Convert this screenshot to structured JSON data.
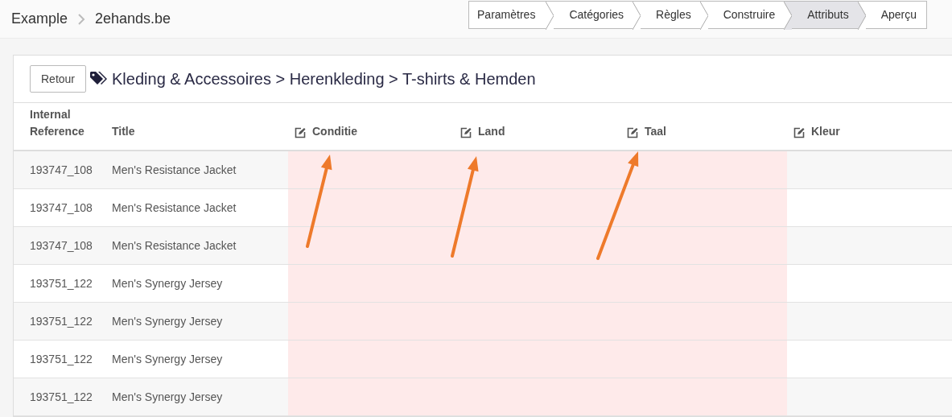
{
  "breadcrumb": [
    "Example",
    "2ehands.be"
  ],
  "steps": [
    {
      "label": "Paramètres",
      "selected": false
    },
    {
      "label": "Catégories",
      "selected": false
    },
    {
      "label": "Règles",
      "selected": false
    },
    {
      "label": "Construire",
      "selected": false
    },
    {
      "label": "Attributs",
      "selected": true
    },
    {
      "label": "Aperçu",
      "selected": false
    }
  ],
  "back_button": "Retour",
  "category_path": "Kleding & Accessoires > Herenkleding > T-shirts & Hemden",
  "table": {
    "columns": [
      {
        "label": "Internal Reference",
        "kind": "text",
        "highlighted": false
      },
      {
        "label": "Title",
        "kind": "text",
        "highlighted": false
      },
      {
        "label": "Conditie",
        "kind": "attribute",
        "highlighted": true
      },
      {
        "label": "Land",
        "kind": "attribute",
        "highlighted": true
      },
      {
        "label": "Taal",
        "kind": "attribute",
        "highlighted": true
      },
      {
        "label": "Kleur",
        "kind": "attribute",
        "highlighted": false
      }
    ],
    "rows": [
      [
        "193747_108",
        "Men's Resistance Jacket"
      ],
      [
        "193747_108",
        "Men's Resistance Jacket"
      ],
      [
        "193747_108",
        "Men's Resistance Jacket"
      ],
      [
        "193751_122",
        "Men's Synergy Jersey"
      ],
      [
        "193751_122",
        "Men's Synergy Jersey"
      ],
      [
        "193751_122",
        "Men's Synergy Jersey"
      ],
      [
        "193751_122",
        "Men's Synergy Jersey"
      ]
    ]
  }
}
